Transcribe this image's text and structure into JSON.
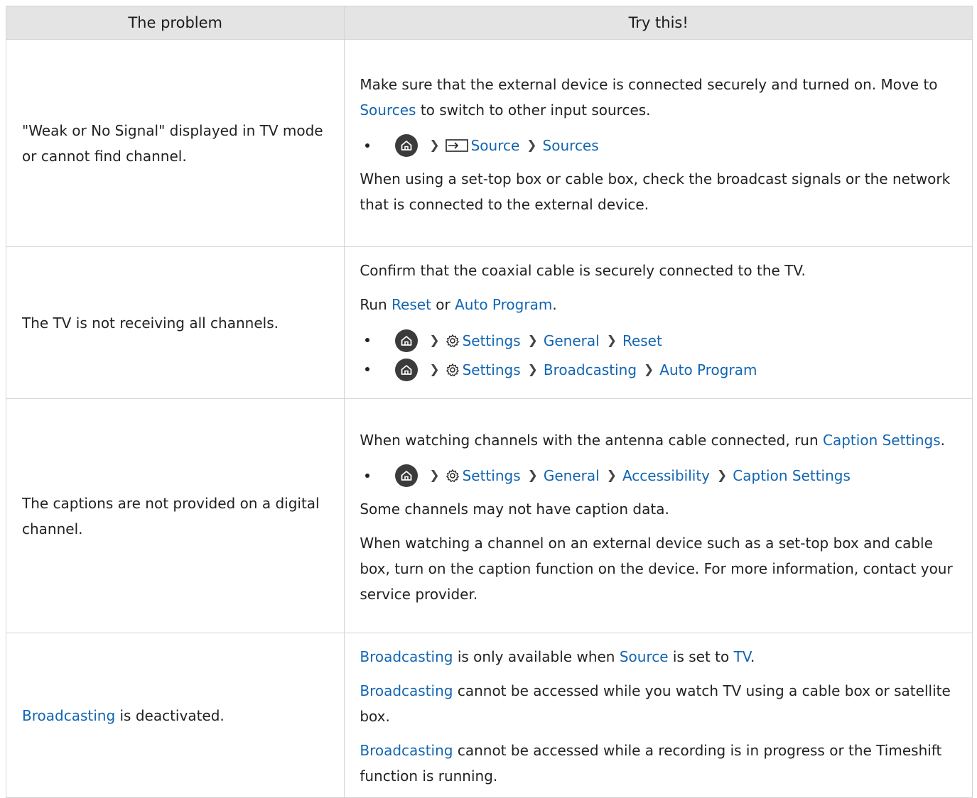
{
  "headers": {
    "problem": "The problem",
    "try": "Try this!"
  },
  "rows": [
    {
      "problem": "\"Weak or No Signal\" displayed in TV mode or cannot find channel.",
      "p1_a": "Make sure that the external device is connected securely and turned on. Move to ",
      "p1_link": "Sources",
      "p1_b": " to switch to other input sources.",
      "path1": [
        "Source",
        "Sources"
      ],
      "p2": "When using a set-top box or cable box, check the broadcast signals or the network that is connected to the external device."
    },
    {
      "problem": "The TV is not receiving all channels.",
      "p1": "Confirm that the coaxial cable is securely connected to the TV.",
      "p2_a": "Run ",
      "p2_link1": "Reset",
      "p2_b": " or ",
      "p2_link2": "Auto Program",
      "p2_c": ".",
      "path1": [
        "Settings",
        "General",
        "Reset"
      ],
      "path2": [
        "Settings",
        "Broadcasting",
        "Auto Program"
      ]
    },
    {
      "problem": "The captions are not provided on a digital channel.",
      "p1_a": "When watching channels with the antenna cable connected, run ",
      "p1_link": "Caption Settings",
      "p1_b": ".",
      "path1": [
        "Settings",
        "General",
        "Accessibility",
        "Caption Settings"
      ],
      "p2": "Some channels may not have caption data.",
      "p3": "When watching a channel on an external device such as a set-top box and cable box, turn on the caption function on the device. For more information, contact your service provider."
    },
    {
      "problem_link": "Broadcasting",
      "problem_rest": " is deactivated.",
      "p1_link1": "Broadcasting",
      "p1_a": " is only available when ",
      "p1_link2": "Source",
      "p1_b": " is set to ",
      "p1_link3": "TV",
      "p1_c": ".",
      "p2_link": "Broadcasting",
      "p2_rest": " cannot be accessed while you watch TV using a cable box or satellite box.",
      "p3_link": "Broadcasting",
      "p3_rest": " cannot be accessed while a recording is in progress or the Timeshift function is running."
    }
  ],
  "colors": {
    "link": "#1265b2",
    "header_bg": "#e4e4e4",
    "border": "#d4d4d4"
  }
}
